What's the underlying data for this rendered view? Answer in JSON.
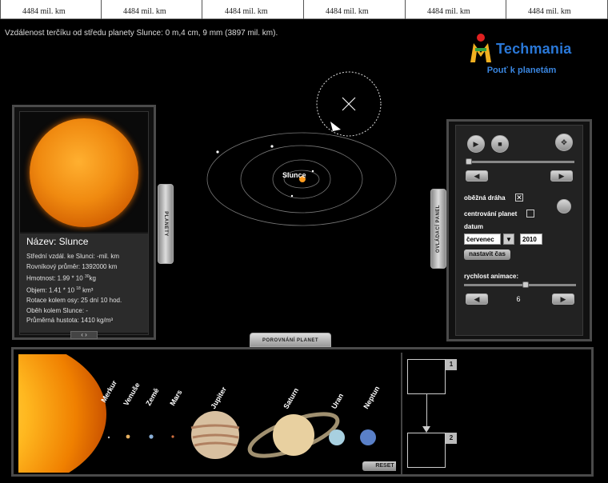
{
  "ruler": {
    "labels": [
      "4484 mil. km",
      "4484 mil. km",
      "4484 mil. km",
      "4484 mil. km",
      "4484 mil. km",
      "4484 mil. km"
    ]
  },
  "distance_text": "Vzdálenost terčíku od středu planety Slunce: 0 m,4 cm, 9 mm (3897 mil. km).",
  "logo": {
    "name": "Techmania",
    "subtitle": "Pouť k planetám"
  },
  "left_panel": {
    "title": "Název: Slunce",
    "rows": {
      "r1": "Střední vzdál. ke Slunci: -mil. km",
      "r2": "Rovníkový průměr: 1392000 km",
      "r3_a": "Hmotnost: 1.99 * 10",
      "r3_exp": "30",
      "r3_b": "kg",
      "r4_a": "Objem: 1.41 * 10",
      "r4_exp": "18",
      "r4_b": "km³",
      "r5": "Rotace kolem osy: 25 dní 10 hod.",
      "r6": "Oběh kolem Slunce: -",
      "r7": "Průměrná hustota: 1410 kg/m³"
    },
    "scroll": "‹  ›"
  },
  "tabs": {
    "planety": "PLANETY",
    "ovladaci": "OVLÁDACÍ PANEL",
    "porovnani": "POROVNÁNÍ PLANET"
  },
  "orbit_view": {
    "center_label": "Slunce"
  },
  "control_panel": {
    "play": "▶",
    "stop": "■",
    "nav": "✥",
    "left": "◀",
    "right": "▶",
    "orbit_label": "oběžná dráha",
    "orbit_checked": "✕",
    "center_label": "centrování planet",
    "center_checked": "",
    "date_label": "datum",
    "month": "červenec",
    "dropdown": "▼",
    "year": "2010",
    "set_time": "nastavit čas",
    "speed_label": "rychlost animace:",
    "speed_value": "6",
    "speed_fraction": 0.55
  },
  "bottom": {
    "planets": [
      "Merkur",
      "Venuše",
      "Země",
      "Mars",
      "Jupiter",
      "Saturn",
      "Uran",
      "Neptun"
    ],
    "reset": "RESET",
    "box1": "1",
    "box2": "2"
  }
}
